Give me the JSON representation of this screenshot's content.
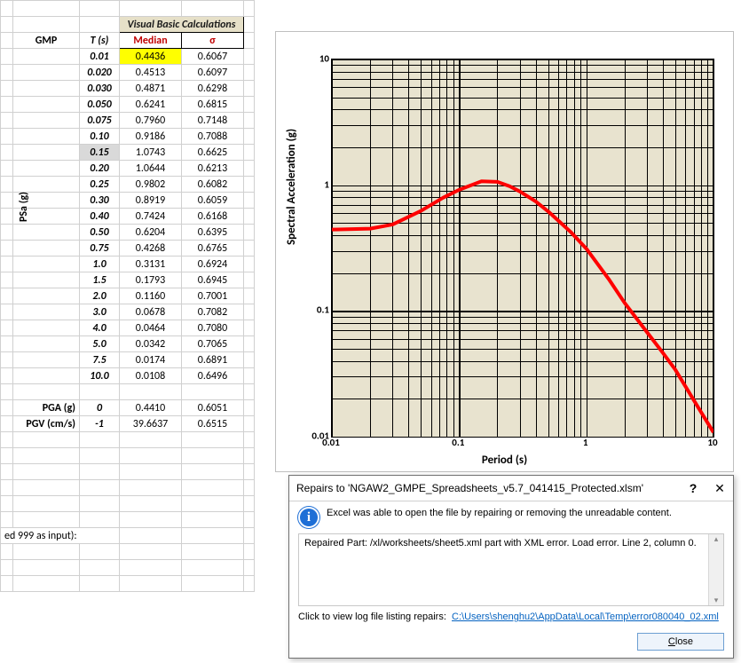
{
  "headers": {
    "vbc": "Visual Basic Calculations",
    "gmp": "GMP",
    "t": "T (s)",
    "median": "Median",
    "sigma": "σ"
  },
  "psa_label": "PSa (g)",
  "pga_label": "PGA (g)",
  "pgv_label": "PGV (cm/s)",
  "footer_note": "ed 999 as input):",
  "rows": [
    {
      "t": "0.01",
      "median": "0.4436",
      "sigma": "0.6067",
      "hl": "yellow"
    },
    {
      "t": "0.020",
      "median": "0.4513",
      "sigma": "0.6097"
    },
    {
      "t": "0.030",
      "median": "0.4871",
      "sigma": "0.6298"
    },
    {
      "t": "0.050",
      "median": "0.6241",
      "sigma": "0.6815"
    },
    {
      "t": "0.075",
      "median": "0.7960",
      "sigma": "0.7148"
    },
    {
      "t": "0.10",
      "median": "0.9186",
      "sigma": "0.7088"
    },
    {
      "t": "0.15",
      "median": "1.0743",
      "sigma": "0.6625",
      "hl": "gray_t"
    },
    {
      "t": "0.20",
      "median": "1.0644",
      "sigma": "0.6213"
    },
    {
      "t": "0.25",
      "median": "0.9802",
      "sigma": "0.6082"
    },
    {
      "t": "0.30",
      "median": "0.8919",
      "sigma": "0.6059"
    },
    {
      "t": "0.40",
      "median": "0.7424",
      "sigma": "0.6168"
    },
    {
      "t": "0.50",
      "median": "0.6204",
      "sigma": "0.6395"
    },
    {
      "t": "0.75",
      "median": "0.4268",
      "sigma": "0.6765"
    },
    {
      "t": "1.0",
      "median": "0.3131",
      "sigma": "0.6924"
    },
    {
      "t": "1.5",
      "median": "0.1793",
      "sigma": "0.6945"
    },
    {
      "t": "2.0",
      "median": "0.1160",
      "sigma": "0.7001"
    },
    {
      "t": "3.0",
      "median": "0.0678",
      "sigma": "0.7082"
    },
    {
      "t": "4.0",
      "median": "0.0464",
      "sigma": "0.7080"
    },
    {
      "t": "5.0",
      "median": "0.0342",
      "sigma": "0.7065"
    },
    {
      "t": "7.5",
      "median": "0.0174",
      "sigma": "0.6891"
    },
    {
      "t": "10.0",
      "median": "0.0108",
      "sigma": "0.6496"
    }
  ],
  "extra_rows": [
    {
      "label": "PGA (g)",
      "t": "0",
      "median": "0.4410",
      "sigma": "0.6051"
    },
    {
      "label": "PGV (cm/s)",
      "t": "-1",
      "median": "39.6637",
      "sigma": "0.6515"
    }
  ],
  "chart_data": {
    "type": "line",
    "title": "",
    "xlabel": "Period (s)",
    "ylabel": "Spectral Acceleration (g)",
    "xscale": "log",
    "yscale": "log",
    "xlim": [
      0.01,
      10
    ],
    "ylim": [
      0.01,
      10
    ],
    "xticks": [
      0.01,
      0.1,
      1,
      10
    ],
    "yticks": [
      0.01,
      0.1,
      1,
      10
    ],
    "series": [
      {
        "name": "Median",
        "color": "#ff0000",
        "x": [
          0.01,
          0.02,
          0.03,
          0.05,
          0.075,
          0.1,
          0.15,
          0.2,
          0.25,
          0.3,
          0.4,
          0.5,
          0.75,
          1.0,
          1.5,
          2.0,
          3.0,
          4.0,
          5.0,
          7.5,
          10.0
        ],
        "y": [
          0.4436,
          0.4513,
          0.4871,
          0.6241,
          0.796,
          0.9186,
          1.0743,
          1.0644,
          0.9802,
          0.8919,
          0.7424,
          0.6204,
          0.4268,
          0.3131,
          0.1793,
          0.116,
          0.0678,
          0.0464,
          0.0342,
          0.0174,
          0.0108
        ]
      }
    ]
  },
  "dialog": {
    "title": "Repairs to 'NGAW2_GMPE_Spreadsheets_v5.7_041415_Protected.xlsm'",
    "message": "Excel was able to open the file by repairing or removing the unreadable content.",
    "log_content": "Repaired Part: /xl/worksheets/sheet5.xml part with XML error.  Load error. Line 2, column 0.",
    "link_intro": "Click to view log file listing repairs:",
    "link_text": "C:\\Users\\shenghu2\\AppData\\Local\\Temp\\error080040_02.xml",
    "close_label": "Close",
    "help": "?",
    "close_x": "✕"
  }
}
